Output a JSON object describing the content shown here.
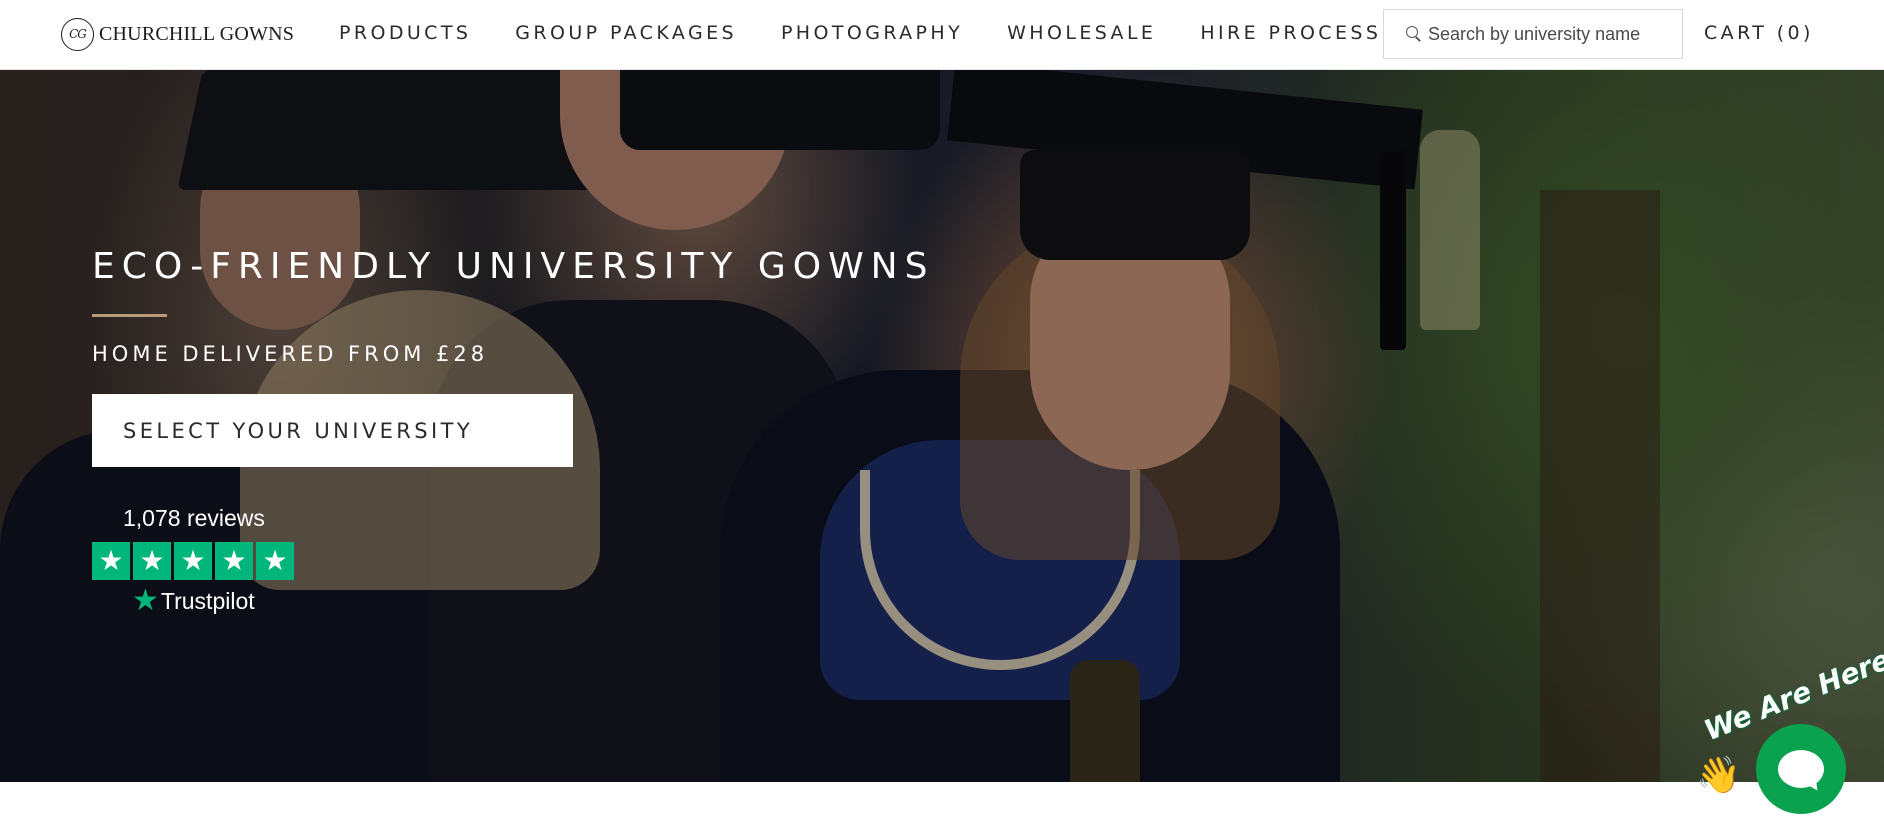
{
  "header": {
    "logo_mark": "CG",
    "logo_text": "CHURCHILL GOWNS",
    "nav": [
      {
        "label": "PRODUCTS"
      },
      {
        "label": "GROUP PACKAGES"
      },
      {
        "label": "PHOTOGRAPHY"
      },
      {
        "label": "WHOLESALE"
      },
      {
        "label": "HIRE PROCESS"
      }
    ],
    "search": {
      "placeholder": "Search by university name",
      "value": ""
    },
    "cart_label": "CART (0)"
  },
  "hero": {
    "title": "ECO-FRIENDLY UNIVERSITY GOWNS",
    "subtitle": "HOME DELIVERED FROM £28",
    "cta_label": "SELECT YOUR UNIVERSITY",
    "accent_color": "#b89a78"
  },
  "trustpilot": {
    "reviews": "1,078 reviews",
    "star_count": 5,
    "star_color": "#00b67a",
    "brand": "Trustpilot"
  },
  "chat": {
    "tag": "We Are Here!",
    "color": "#0aa14f",
    "icon": "chat-bubble-icon"
  }
}
